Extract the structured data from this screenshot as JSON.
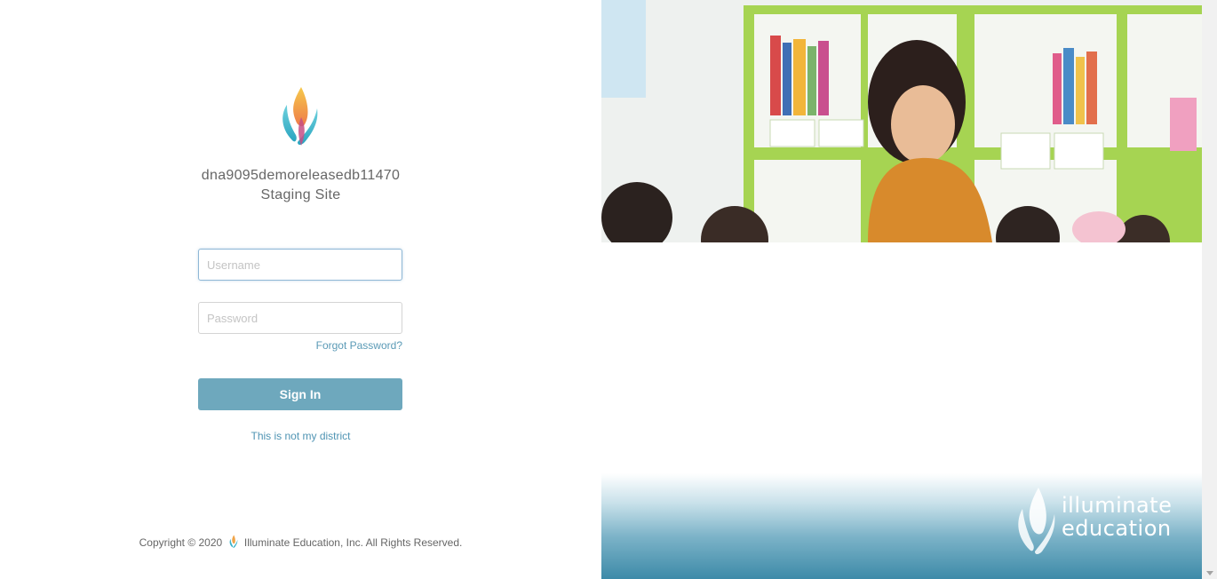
{
  "site": {
    "name_line1": "dna9095demoreleasedb11470",
    "name_line2": "Staging Site"
  },
  "login": {
    "username_placeholder": "Username",
    "password_placeholder": "Password",
    "forgot_label": "Forgot Password?",
    "signin_label": "Sign In",
    "not_district_label": "This is not my district"
  },
  "footer": {
    "copyright_prefix": "Copyright © 2020",
    "company_suffix": "Illuminate Education, Inc. All Rights Reserved."
  },
  "brand": {
    "line1": "illuminate",
    "line2": "education"
  },
  "colors": {
    "accent": "#6ea8bd",
    "link": "#4f94b3",
    "brand_gradient_end": "#3d8aa8"
  },
  "icons": {
    "flame_logo": "flame-logo-icon",
    "brand_flame": "brand-flame-icon"
  }
}
